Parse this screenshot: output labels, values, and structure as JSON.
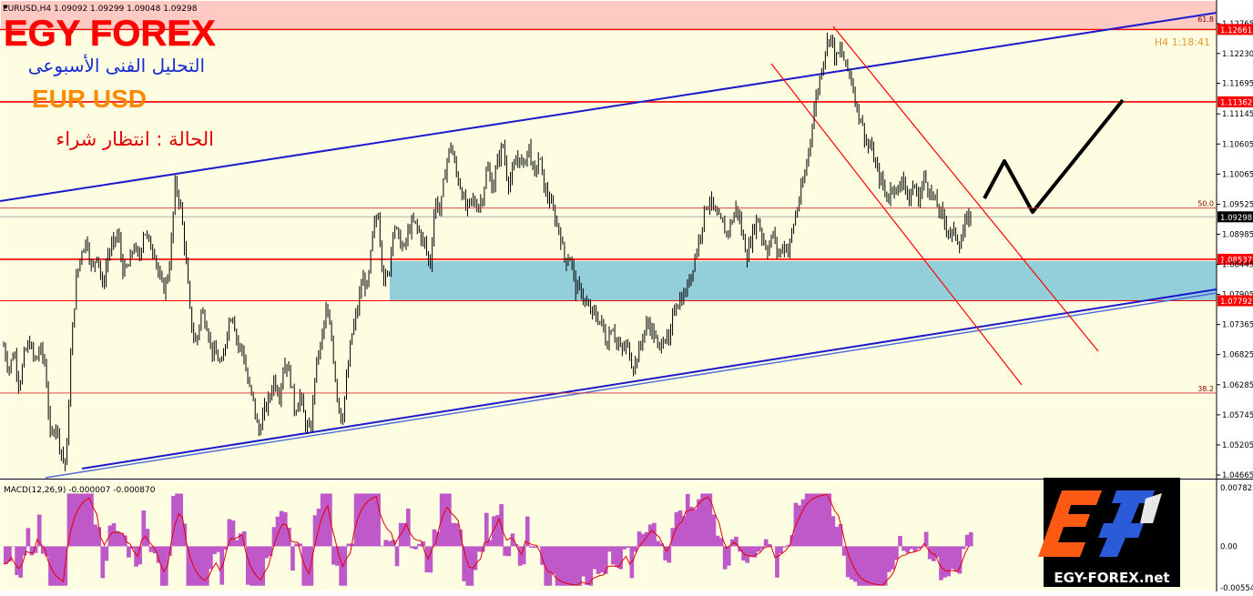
{
  "header": {
    "symbol_line": "EURUSD,H4  1.09092 1.09299 1.09048 1.09298",
    "timer": "H4   1:18:41"
  },
  "overlay": {
    "brand": "EGY FOREX",
    "subtitle_ar": "التحليل الفنى الأسبوعى",
    "pair": "EUR USD",
    "status_ar": "الحالة : انتظار شراء"
  },
  "logo": {
    "text": "EGY-FOREX.net"
  },
  "colors": {
    "background": "#fdfde2",
    "candle": "#000000",
    "red_level": "#ff0000",
    "channel_blue": "#1a1acc",
    "zone_fill": "#92cfdb",
    "top_band": "#ffc9c4",
    "macd_hist": "#bf58c8",
    "macd_signal": "#e00000",
    "brand_red": "#ff0000",
    "subtitle_blue": "#1a2bd6",
    "pair_orange": "#ff8a00",
    "status_red": "#e00000",
    "timer_orange": "#e39a2e",
    "logo_orange": "#ff5a14",
    "logo_blue": "#2b5bd8"
  },
  "chart_data": [
    {
      "type": "candlestick",
      "title": "EURUSD,H4",
      "ylim": [
        1.04665,
        1.12765
      ],
      "y_ticks": [
        "1.12765",
        "1.12661",
        "1.12230",
        "1.11695",
        "1.11362",
        "1.11145",
        "1.10605",
        "1.10065",
        "1.09525",
        "1.09298",
        "1.08985",
        "1.08537",
        "1.08445",
        "1.07905",
        "1.07792",
        "1.07365",
        "1.06825",
        "1.06285",
        "1.05745",
        "1.05205",
        "1.04665"
      ],
      "levels": [
        {
          "value": 1.12661,
          "label": "1.12661",
          "style": "red"
        },
        {
          "value": 1.11362,
          "label": "1.11362",
          "style": "red"
        },
        {
          "value": 1.09298,
          "label": "1.09298",
          "style": "current"
        },
        {
          "value": 1.08537,
          "label": "1.08537",
          "style": "red"
        },
        {
          "value": 1.07792,
          "label": "1.07792",
          "style": "red-thin"
        }
      ],
      "fibo_labels": [
        {
          "label": "61.8",
          "value": 1.12765
        },
        {
          "label": "50.0",
          "value": 1.09455
        },
        {
          "label": "38.2",
          "value": 1.06136
        }
      ],
      "zone": {
        "from": 1.07792,
        "to": 1.08537
      },
      "price_path": [
        1.0698,
        1.0655,
        1.069,
        1.0625,
        1.0683,
        1.0705,
        1.0668,
        1.0695,
        1.0662,
        1.053,
        1.056,
        1.051,
        1.048,
        1.07,
        1.082,
        1.087,
        1.089,
        1.083,
        1.087,
        1.08,
        1.086,
        1.088,
        1.09,
        1.083,
        1.084,
        1.088,
        1.085,
        1.091,
        1.088,
        1.087,
        1.0815,
        1.08,
        1.085,
        1.099,
        1.095,
        1.086,
        1.074,
        1.07,
        1.076,
        1.074,
        1.069,
        1.068,
        1.066,
        1.073,
        1.076,
        1.07,
        1.069,
        1.063,
        1.06,
        1.054,
        1.058,
        1.06,
        1.064,
        1.061,
        1.067,
        1.065,
        1.058,
        1.061,
        1.056,
        1.054,
        1.066,
        1.07,
        1.076,
        1.072,
        1.062,
        1.056,
        1.064,
        1.072,
        1.076,
        1.082,
        1.08,
        1.09,
        1.094,
        1.082,
        1.082,
        1.092,
        1.089,
        1.087,
        1.091,
        1.092,
        1.09,
        1.088,
        1.084,
        1.096,
        1.094,
        1.102,
        1.106,
        1.101,
        1.098,
        1.094,
        1.096,
        1.095,
        1.096,
        1.102,
        1.098,
        1.103,
        1.106,
        1.099,
        1.101,
        1.104,
        1.102,
        1.106,
        1.1,
        1.104,
        1.098,
        1.096,
        1.093,
        1.09,
        1.085,
        1.086,
        1.08,
        1.08,
        1.077,
        1.076,
        1.075,
        1.074,
        1.07,
        1.074,
        1.07,
        1.069,
        1.07,
        1.066,
        1.068,
        1.072,
        1.074,
        1.072,
        1.069,
        1.072,
        1.07,
        1.077,
        1.078,
        1.079,
        1.082,
        1.086,
        1.09,
        1.095,
        1.096,
        1.093,
        1.092,
        1.09,
        1.092,
        1.095,
        1.09,
        1.086,
        1.09,
        1.093,
        1.089,
        1.087,
        1.09,
        1.086,
        1.088,
        1.087,
        1.092,
        1.096,
        1.1,
        1.106,
        1.113,
        1.118,
        1.123,
        1.126,
        1.121,
        1.123,
        1.12,
        1.118,
        1.113,
        1.11,
        1.106,
        1.105,
        1.101,
        1.099,
        1.096,
        1.099,
        1.097,
        1.101,
        1.095,
        1.099,
        1.096,
        1.1,
        1.098,
        1.096,
        1.094,
        1.092,
        1.09,
        1.09,
        1.088,
        1.092,
        1.093
      ]
    },
    {
      "type": "histogram",
      "title": "MACD(12,26,9) -0.000007 -0.000870",
      "ylim": [
        -0.00554,
        0.00782
      ],
      "y_ticks": [
        "0.007825",
        "0.00",
        "-0.005547"
      ],
      "series": [
        {
          "name": "MACD",
          "kind": "histogram"
        },
        {
          "name": "Signal",
          "kind": "line"
        }
      ]
    }
  ]
}
